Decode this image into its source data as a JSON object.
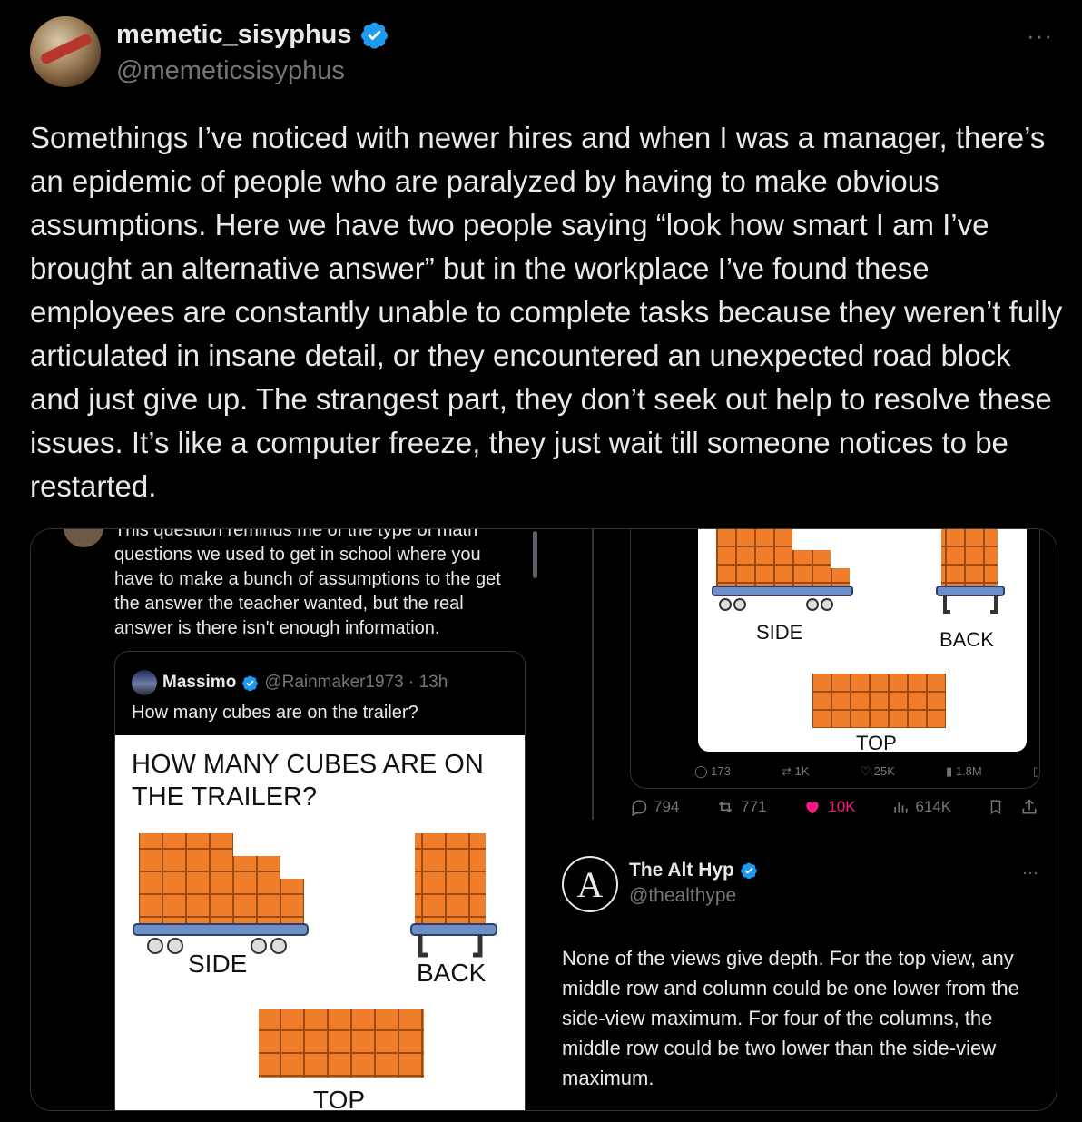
{
  "tweet": {
    "author_name": "memetic_sisyphus",
    "handle": "@memeticsisyphus",
    "more": "···",
    "text": "Somethings I’ve noticed with newer hires and when I was a manager, there’s an epidemic of people who are paralyzed by having to make obvious assumptions. Here we have two people saying “look how smart I am I’ve brought an alternative answer” but in the workplace I’ve found these employees are constantly unable to complete tasks because they weren’t fully articulated in insane detail, or they encountered an unexpected road block and just give up. The strangest part, they don’t seek out help to resolve these issues. It’s like a computer freeze, they just wait till someone notices to be restarted."
  },
  "left_screenshot": {
    "reply_text": "This question reminds me of the type of math questions we used to get in school where you have to make a bunch of assumptions to the get the answer the teacher wanted, but the real answer is there isn't enough information.",
    "quote": {
      "name": "Massimo",
      "handle": "@Rainmaker1973 · 13h",
      "text": "How many cubes are on the trailer?",
      "image_title": "HOW MANY CUBES ARE ON THE TRAILER?",
      "side_label": "SIDE",
      "back_label": "BACK",
      "top_label": "TOP"
    }
  },
  "right_screenshot": {
    "inner_labels": {
      "side": "SIDE",
      "back": "BACK",
      "top": "TOP"
    },
    "inner_stats": [
      "173",
      "1K",
      "25K",
      "1.8M"
    ],
    "actions": {
      "replies": "794",
      "reposts": "771",
      "likes": "10K",
      "views": "614K"
    },
    "alt_reply": {
      "name": "The Alt Hyp",
      "handle": "@thealthype",
      "avatar_letter": "A",
      "more": "···",
      "text": "None of the views give depth. For the top view, any middle row and column could be one lower from the side-view maximum. For four of the columns, the middle row could be two lower than the side-view maximum."
    }
  },
  "colors": {
    "accent": "#1d9bf0",
    "like": "#f91880",
    "cube": "#f07d2a",
    "trailer": "#6c8fc9"
  }
}
